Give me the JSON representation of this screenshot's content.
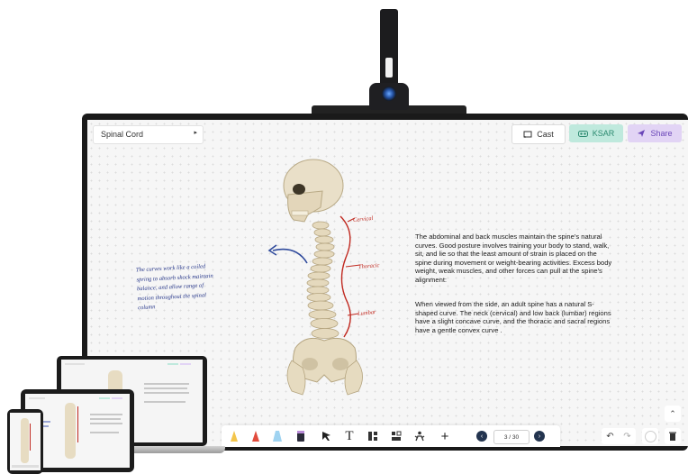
{
  "document": {
    "selector_label": "Spinal Cord",
    "selector_caret": "▸"
  },
  "header_actions": {
    "cast_label": "Cast",
    "ksar_label": "KSAR",
    "share_label": "Share"
  },
  "content": {
    "paragraph_1": "The abdominal and back muscles maintain the spine's natural curves. Good posture involves training your body to stand, walk, sit, and lie so that the least amount of strain is placed on the spine during movement or weight-bearing activities. Excess body weight, weak muscles, and other forces can pull at the spine's alignment:",
    "paragraph_2": "When viewed from the side, an adult spine has a natural S-shaped curve. The neck (cervical) and low back (lumbar) regions have a slight concave curve, and the thoracic and sacral regions have a gentle convex curve .",
    "handwritten_note": "The curves work like a coiled spring to absorb shock maintain balance, and allow range of motion throughout the spinal column",
    "annotations": {
      "cervical": "Cervical",
      "thoracic": "Thoracic",
      "lumbar": "Lumbar"
    }
  },
  "toolbar": {
    "page_indicator": "3 / 30",
    "text_tool_glyph": "T",
    "plus_glyph": "+",
    "prev_glyph": "‹",
    "next_glyph": "›"
  },
  "right_controls": {
    "scroll_up_glyph": "⌃",
    "undo_glyph": "↶",
    "redo_glyph": "↷"
  },
  "colors": {
    "ksar_bg": "#bfe9dd",
    "share_bg": "#e2d4f5",
    "annotation_red": "#c0281f",
    "arrow_blue": "#2f4a9c"
  }
}
